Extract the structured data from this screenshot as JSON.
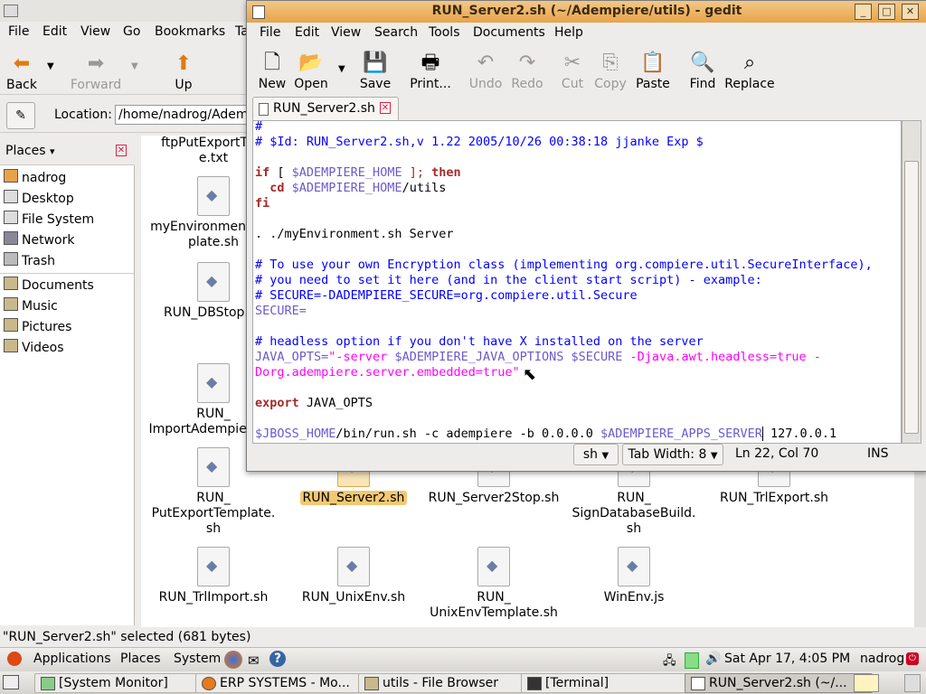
{
  "nautilus": {
    "menu": [
      "File",
      "Edit",
      "View",
      "Go",
      "Bookmarks",
      "Ta"
    ],
    "toolbar": {
      "back": "Back",
      "forward": "Forward",
      "up": "Up"
    },
    "location_label": "Location:",
    "location_value": "/home/nadrog/Adempiere/utils",
    "places_title": "Places",
    "places": [
      "nadrog",
      "Desktop",
      "File System",
      "Network",
      "Trash",
      "Documents",
      "Music",
      "Pictures",
      "Videos"
    ],
    "files": {
      "f1": "ftpPutExportTem\ne.txt",
      "f2": "myEnvironmentTem\nplate.sh",
      "f3": "RUN_DBStop.sh",
      "f4": "RUN_\nImportAdempiere.sh",
      "f5": "RUN_\nPutExportTemplate.\nsh",
      "f6": "RUN_Server2.sh",
      "f7": "RUN_Server2Stop.sh",
      "f8": "RUN_\nSignDatabaseBuild.\nsh",
      "f9": "RUN_TrlExport.sh",
      "f10": "RUN_TrlImport.sh",
      "f11": "RUN_UnixEnv.sh",
      "f12": "RUN_\nUnixEnvTemplate.sh",
      "f13": "WinEnv.js"
    },
    "status": "\"RUN_Server2.sh\" selected (681 bytes)"
  },
  "gedit": {
    "title": "RUN_Server2.sh (~/Adempiere/utils) - gedit",
    "menu": [
      "File",
      "Edit",
      "View",
      "Search",
      "Tools",
      "Documents",
      "Help"
    ],
    "toolbar": {
      "new": "New",
      "open": "Open",
      "save": "Save",
      "print": "Print...",
      "undo": "Undo",
      "redo": "Redo",
      "cut": "Cut",
      "copy": "Copy",
      "paste": "Paste",
      "find": "Find",
      "replace": "Replace"
    },
    "tab_label": "RUN_Server2.sh",
    "code": {
      "l1": "#",
      "l2": "# $Id: RUN_Server2.sh,v 1.22 2005/10/26 00:38:18 jjanke Exp $",
      "l3_if": "if",
      "l3_mid": " [ ",
      "l3_var": "$ADEMPIERE_HOME",
      "l3_end": " ]; ",
      "l3_then": "then",
      "l4_cd": "  cd ",
      "l4_var": "$ADEMPIERE_HOME",
      "l4_end": "/utils",
      "l5": "fi",
      "l6": ". ./myEnvironment.sh Server",
      "l7": "# To use your own Encryption class (implementing org.compiere.util.SecureInterface),",
      "l8": "# you need to set it here (and in the client start script) - example:",
      "l9": "# SECURE=-DADEMPIERE_SECURE=org.compiere.util.Secure",
      "l10": "SECURE=",
      "l11": "# headless option if you don't have X installed on the server",
      "l12_var": "JAVA_OPTS=",
      "l12_str1": "\"-server ",
      "l12_v1": "$ADEMPIERE_JAVA_OPTIONS",
      "l12_sp": " ",
      "l12_v2": "$SECURE",
      "l12_str2": " -Djava.awt.headless=true -",
      "l13": "Dorg.adempiere.server.embedded=true\"",
      "l14_kw": "export",
      "l14_rest": " JAVA_OPTS",
      "l15_v1": "$JBOSS_HOME",
      "l15_mid": "/bin/run.sh -c adempiere -b 0.0.0.0 ",
      "l15_v2": "$ADEMPIERE_APPS_SERVER",
      "l15_end": " 127.0.0.1"
    },
    "status": {
      "language": "sh",
      "tab_width": "Tab Width: 8",
      "position": "Ln 22, Col 70",
      "mode": "INS"
    }
  },
  "top_panel": {
    "applications": "Applications",
    "places": "Places",
    "system": "System",
    "clock": "Sat Apr 17,  4:05 PM",
    "user": "nadrog"
  },
  "taskbar": [
    "[System Monitor]",
    "ERP SYSTEMS - Mo...",
    "utils - File Browser",
    "[Terminal]",
    "RUN_Server2.sh (~/..."
  ]
}
